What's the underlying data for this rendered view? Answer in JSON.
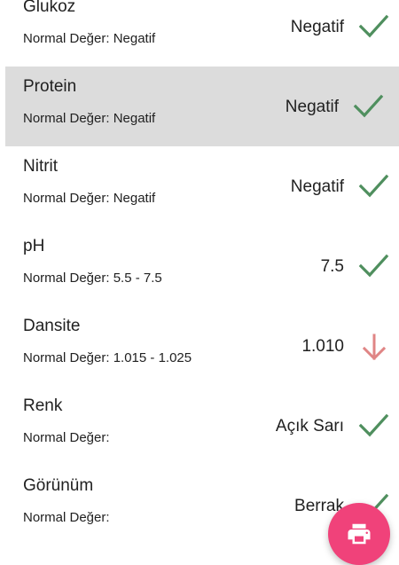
{
  "colors": {
    "ok_check": "#4f8f5e",
    "warn_arrow": "#e08585",
    "fab": "#f0427a",
    "selected_row": "#dcdcdc"
  },
  "results": [
    {
      "name": "Glukoz",
      "normal": "Normal Değer: Negatif",
      "value": "Negatif",
      "status": "check-icon"
    },
    {
      "name": "Protein",
      "normal": "Normal Değer: Negatif",
      "value": "Negatif",
      "status": "check-icon",
      "selected": true
    },
    {
      "name": "Nitrit",
      "normal": "Normal Değer: Negatif",
      "value": "Negatif",
      "status": "check-icon"
    },
    {
      "name": "pH",
      "normal": "Normal Değer: 5.5 - 7.5",
      "value": "7.5",
      "status": "check-icon"
    },
    {
      "name": "Dansite",
      "normal": "Normal Değer: 1.015 - 1.025",
      "value": "1.010",
      "status": "arrow-down-icon"
    },
    {
      "name": "Renk",
      "normal": "Normal Değer:",
      "value": "Açık Sarı",
      "status": "check-icon"
    },
    {
      "name": "Görünüm",
      "normal": "Normal Değer:",
      "value": "Berrak",
      "status": "check-icon"
    }
  ],
  "fab": {
    "icon": "print-icon"
  }
}
